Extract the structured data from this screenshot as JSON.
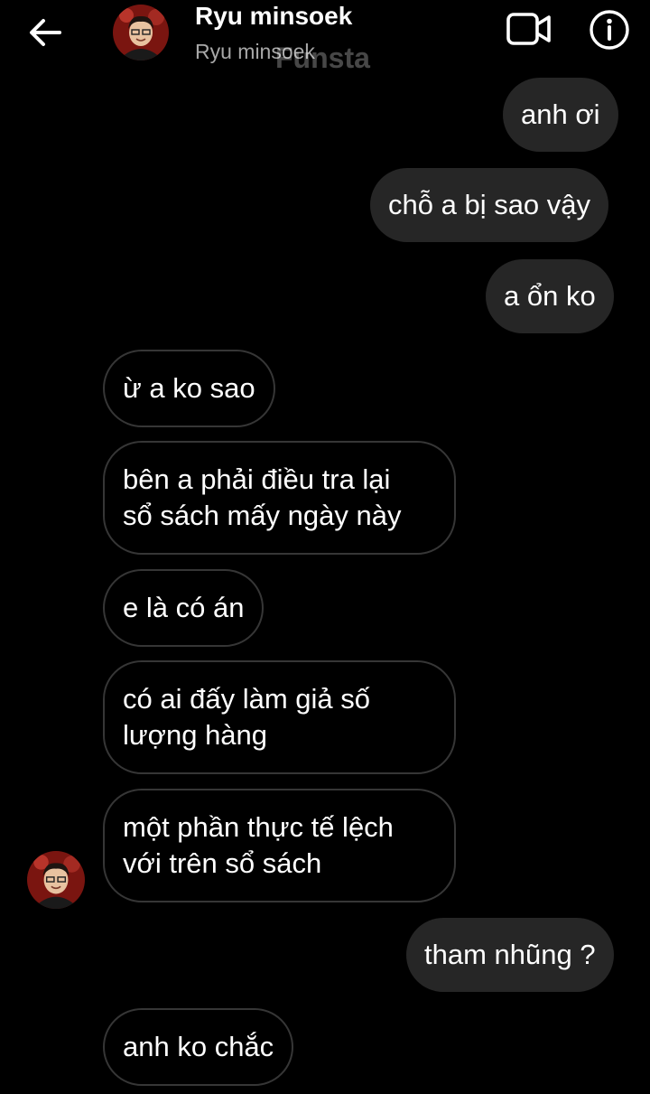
{
  "header": {
    "title": "Ryu minsoek",
    "subtitle": "Ryu minsoek",
    "watermark": "Funsta",
    "back_icon": "back-arrow-icon",
    "video_icon": "video-call-icon",
    "info_icon": "info-icon"
  },
  "messages": [
    {
      "sender": "me",
      "text": "anh ơi"
    },
    {
      "sender": "me",
      "text": "chỗ a bị sao vậy"
    },
    {
      "sender": "me",
      "text": "a ổn ko"
    },
    {
      "sender": "them",
      "text": "ừ a ko sao"
    },
    {
      "sender": "them",
      "text": "bên a phải điều tra lại\nsổ sách mấy ngày này"
    },
    {
      "sender": "them",
      "text": "e là có án"
    },
    {
      "sender": "them",
      "text": "có ai đấy làm giả số\nlượng hàng"
    },
    {
      "sender": "them",
      "text": "một phần thực tế lệch\nvới trên sổ sách"
    },
    {
      "sender": "me",
      "text": "tham nhũng ?"
    },
    {
      "sender": "them",
      "text": "anh ko chắc"
    }
  ],
  "colors": {
    "background": "#000000",
    "outgoing_bubble": "#262626",
    "incoming_border": "#363636",
    "subtitle": "#a8a8a8"
  }
}
